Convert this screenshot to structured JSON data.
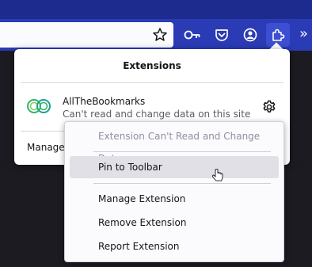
{
  "panel": {
    "title": "Extensions",
    "extension": {
      "name": "AllTheBookmarks",
      "description": "Can't read and change data on this site"
    },
    "manage_extensions_label": "Manage extensions"
  },
  "context_menu": {
    "items": [
      {
        "label": "Extension Can't Read and Change Data",
        "disabled": true
      },
      {
        "label": "Pin to Toolbar",
        "hovered": true
      },
      {
        "label": "Manage Extension"
      },
      {
        "label": "Remove Extension"
      },
      {
        "label": "Report Extension"
      }
    ]
  },
  "toolbar": {
    "overflow_label": "»"
  },
  "colors": {
    "toolbar_bg": "#2a3bb5",
    "titlebar_bg": "#1d2b8f",
    "active_button": "#3c4fd0",
    "logo_green": "#2bb673"
  },
  "icons": [
    "star-icon",
    "key-icon",
    "pocket-icon",
    "account-icon",
    "extensions-icon",
    "gear-icon",
    "cursor-icon"
  ]
}
